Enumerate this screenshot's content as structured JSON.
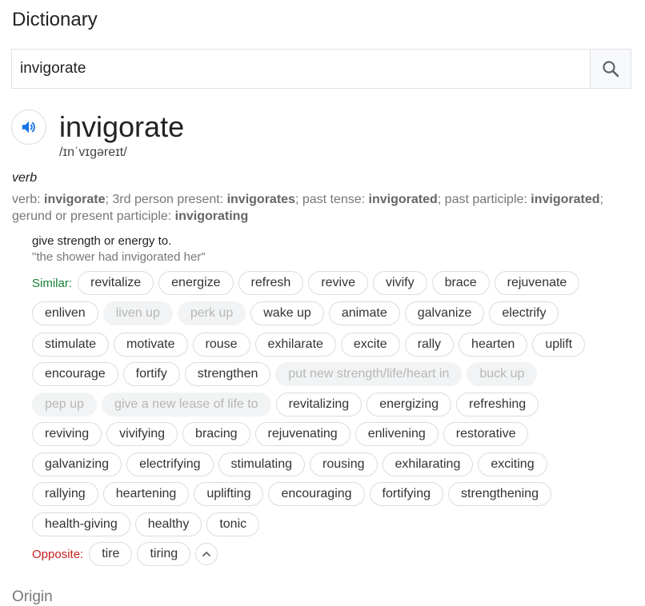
{
  "page": {
    "title": "Dictionary"
  },
  "search": {
    "value": "invigorate",
    "icon": "search-icon"
  },
  "entry": {
    "word": "invigorate",
    "phonetic": "/ɪnˈvɪɡəreɪt/",
    "pos": "verb",
    "forms": {
      "prefix": "verb: ",
      "base": "invigorate",
      "third_label": "; 3rd person present: ",
      "third": "invigorates",
      "past_label": "; past tense: ",
      "past": "invigorated",
      "pp_label": "; past participle: ",
      "pp": "invigorated",
      "ger_label": "; gerund or present participle: ",
      "ger": "invigorating"
    },
    "definition": "give strength or energy to.",
    "example": "\"the shower had invigorated her\""
  },
  "similar_label": "Similar:",
  "opposite_label": "Opposite:",
  "similar_rows": [
    [
      {
        "t": "revitalize"
      },
      {
        "t": "energize"
      },
      {
        "t": "refresh"
      },
      {
        "t": "revive"
      },
      {
        "t": "vivify"
      },
      {
        "t": "brace"
      },
      {
        "t": "rejuvenate"
      }
    ],
    [
      {
        "t": "enliven"
      },
      {
        "t": "liven up",
        "faded": true
      },
      {
        "t": "perk up",
        "faded": true
      },
      {
        "t": "wake up"
      },
      {
        "t": "animate"
      },
      {
        "t": "galvanize"
      },
      {
        "t": "electrify"
      }
    ],
    [
      {
        "t": "stimulate"
      },
      {
        "t": "motivate"
      },
      {
        "t": "rouse"
      },
      {
        "t": "exhilarate"
      },
      {
        "t": "excite"
      },
      {
        "t": "rally"
      },
      {
        "t": "hearten"
      },
      {
        "t": "uplift"
      }
    ],
    [
      {
        "t": "encourage"
      },
      {
        "t": "fortify"
      },
      {
        "t": "strengthen"
      },
      {
        "t": "put new strength/life/heart in",
        "faded": true
      },
      {
        "t": "buck up",
        "faded": true
      }
    ],
    [
      {
        "t": "pep up",
        "faded": true
      },
      {
        "t": "give a new lease of life to",
        "faded": true
      },
      {
        "t": "revitalizing"
      },
      {
        "t": "energizing"
      },
      {
        "t": "refreshing"
      }
    ],
    [
      {
        "t": "reviving"
      },
      {
        "t": "vivifying"
      },
      {
        "t": "bracing"
      },
      {
        "t": "rejuvenating"
      },
      {
        "t": "enlivening"
      },
      {
        "t": "restorative"
      }
    ],
    [
      {
        "t": "galvanizing"
      },
      {
        "t": "electrifying"
      },
      {
        "t": "stimulating"
      },
      {
        "t": "rousing"
      },
      {
        "t": "exhilarating"
      },
      {
        "t": "exciting"
      }
    ],
    [
      {
        "t": "rallying"
      },
      {
        "t": "heartening"
      },
      {
        "t": "uplifting"
      },
      {
        "t": "encouraging"
      },
      {
        "t": "fortifying"
      },
      {
        "t": "strengthening"
      }
    ],
    [
      {
        "t": "health-giving"
      },
      {
        "t": "healthy"
      },
      {
        "t": "tonic"
      }
    ]
  ],
  "opposites": [
    {
      "t": "tire"
    },
    {
      "t": "tiring"
    }
  ],
  "origin_label": "Origin",
  "colors": {
    "similar": "#188038",
    "opposite": "#c5221f",
    "speaker": "#1a73e8"
  }
}
